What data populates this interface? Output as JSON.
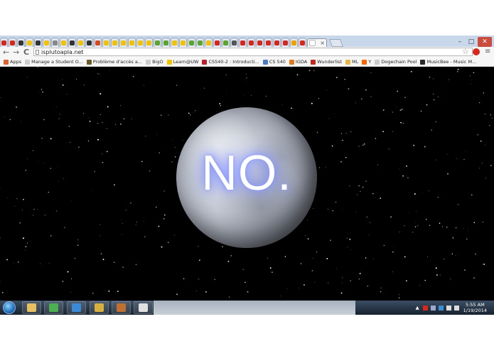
{
  "browser": {
    "url": "isplutoapla.net",
    "tab_favicon_colors": [
      "#d8261c",
      "#d8261c",
      "#333333",
      "#f2c200",
      "#333333",
      "#f2c200",
      "#888888",
      "#f2c200",
      "#333333",
      "#f2c200",
      "#333333",
      "#d84a1c",
      "#f2c200",
      "#f2c200",
      "#f2c200",
      "#f2c200",
      "#f2c200",
      "#f2c200",
      "#5aa52a",
      "#5aa52a",
      "#f2c200",
      "#f2c200",
      "#5aa52a",
      "#5aa52a",
      "#f2c200",
      "#d8261c",
      "#5aa52a",
      "#555555",
      "#d8261c",
      "#d8261c",
      "#d8261c",
      "#d8261c",
      "#d8261c",
      "#d8261c",
      "#f2a000",
      "#d8261c"
    ],
    "active_tab_close": "×",
    "window_controls": {
      "minimize": "–",
      "maximize": "□",
      "close": "✕"
    },
    "nav_icons": {
      "back": "←",
      "forward": "→",
      "reload": "C"
    },
    "bookmarks": [
      {
        "label": "Apps",
        "icon": "apps-grid-icon",
        "color": "#e06030"
      },
      {
        "label": "Manage a Student O...",
        "icon": "page-icon",
        "color": "#cccccc"
      },
      {
        "label": "Problème d'accès a...",
        "icon": "image-icon",
        "color": "#6b5a2a"
      },
      {
        "label": "BigO",
        "icon": "page-icon",
        "color": "#cccccc"
      },
      {
        "label": "Learn@UW",
        "icon": "star-icon",
        "color": "#f2c200"
      },
      {
        "label": "CS540-2 : Introducti...",
        "icon": "crest-icon",
        "color": "#b8202a"
      },
      {
        "label": "CS 540",
        "icon": "p-icon",
        "color": "#4a7bc8"
      },
      {
        "label": "IGDA",
        "icon": "igda-icon",
        "color": "#e07a20"
      },
      {
        "label": "Wunderlist",
        "icon": "wunderlist-icon",
        "color": "#c22a20"
      },
      {
        "label": "ML",
        "icon": "folder-icon",
        "color": "#e6b84a"
      },
      {
        "label": "Y",
        "icon": "hacker-news-icon",
        "color": "#ff6600"
      },
      {
        "label": "Dogechain Pool",
        "icon": "page-icon",
        "color": "#cccccc"
      },
      {
        "label": "MusicBee - Music M...",
        "icon": "musicbee-icon",
        "color": "#2a2a2a"
      }
    ]
  },
  "page": {
    "headline": "NO.",
    "background": "#000000",
    "glow_color": "#5b6cff"
  },
  "taskbar": {
    "time": "5:55 AM",
    "date": "1/19/2014",
    "pinned": [
      {
        "name": "windows-explorer-icon",
        "color": "#e8c060"
      },
      {
        "name": "chrome-icon",
        "color": "#4caf50"
      },
      {
        "name": "itunes-icon",
        "color": "#3a8ad8"
      },
      {
        "name": "folder-icon",
        "color": "#d8b040"
      },
      {
        "name": "sublime-icon",
        "color": "#c07030"
      },
      {
        "name": "notepad-icon",
        "color": "#e0e0e0"
      }
    ]
  }
}
